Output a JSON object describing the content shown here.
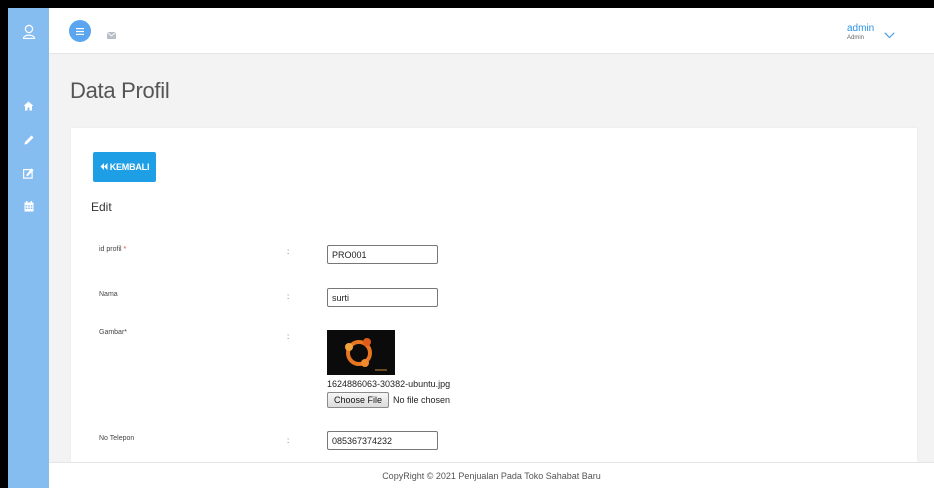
{
  "topbar": {
    "user_name": "admin",
    "user_role": "Admin"
  },
  "page": {
    "title": "Data Profil"
  },
  "card": {
    "back_label": "KEMBALI",
    "section_title": "Edit"
  },
  "form": {
    "id_profil": {
      "label": "id profil",
      "required_mark": "*",
      "value": "PRO001"
    },
    "nama": {
      "label": "Nama",
      "value": "surti"
    },
    "gambar": {
      "label": "Gambar*",
      "file_name": "1624886063-30382-ubuntu.jpg",
      "choose_label": "Choose File",
      "no_file_label": "No file chosen"
    },
    "no_telepon": {
      "label": "No Telepon",
      "value": "085367374232"
    },
    "colon": ":"
  },
  "footer": {
    "text": "CopyRight © 2021 Penjualan Pada Toko Sahabat Baru"
  },
  "colors": {
    "sidebar": "#86bdf0",
    "accent": "#1e9ee5",
    "background": "#f3f3f3"
  },
  "icons": [
    "user-icon",
    "home-icon",
    "pencil-icon",
    "edit-icon",
    "calendar-icon",
    "menu-icon",
    "mail-icon",
    "chevron-down-icon",
    "double-chevron-left-icon"
  ]
}
